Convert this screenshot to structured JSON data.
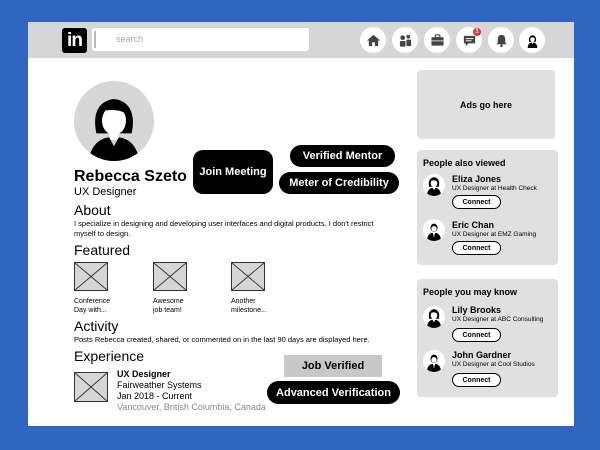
{
  "topbar": {
    "logo": "in",
    "search_placeholder": "search",
    "icons": [
      "home-icon",
      "network-icon",
      "jobs-icon",
      "messaging-icon",
      "notifications-icon",
      "me-avatar-icon"
    ],
    "message_badge": "1"
  },
  "profile": {
    "name": "Rebecca Szeto",
    "headline": "UX Designer"
  },
  "actions": {
    "join_meeting": "Join Meeting",
    "verified_mentor": "Verified Mentor",
    "meter_of_credibility": "Meter of Credibility",
    "job_verified": "Job Verified",
    "advanced_verification": "Advanced Verification"
  },
  "about": {
    "heading": "About",
    "text": "I specialize in designing and developing user interfaces and digital products. I don't restrict myself to design."
  },
  "featured": {
    "heading": "Featured",
    "items": [
      {
        "caption_1": "Conference",
        "caption_2": "Day with..."
      },
      {
        "caption_1": "Awesome",
        "caption_2": "job team!"
      },
      {
        "caption_1": "Another",
        "caption_2": "milestone..."
      }
    ]
  },
  "activity": {
    "heading": "Activity",
    "text": "Posts Rebecca created, shared, or commented on in the last 90 days are displayed here."
  },
  "experience": {
    "heading": "Experience",
    "title": "UX Designer",
    "company": "Fairweather Systems",
    "dates": "Jan 2018 - Current",
    "location": "Vancouver, British Columbia, Canada"
  },
  "ads": {
    "label": "Ads go here"
  },
  "people_also_viewed": {
    "title": "People also viewed",
    "people": [
      {
        "name": "Eliza Jones",
        "role": "UX Designer at Health Check",
        "button": "Connect"
      },
      {
        "name": "Eric Chan",
        "role": "UX Designer at EMZ Gaming",
        "button": "Connect"
      }
    ]
  },
  "people_you_may_know": {
    "title": "People you may know",
    "people": [
      {
        "name": "Lily Brooks",
        "role": "UX Designer at ABC Consulting",
        "button": "Connect"
      },
      {
        "name": "John Gardner",
        "role": "UX Designer at Cool Studios",
        "button": "Connect"
      }
    ]
  },
  "colors": {
    "background": "#2f66c1",
    "topbar": "#d6d6d6",
    "card": "#e0e0e0",
    "button": "#000000",
    "badge": "#e03535"
  }
}
